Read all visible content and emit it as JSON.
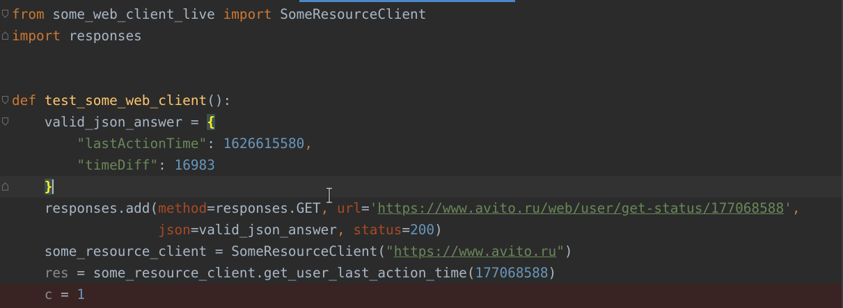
{
  "editor": {
    "language": "python",
    "accent_color": "#4a88c7",
    "lines": [
      {
        "kw_from": "from",
        "module": " some_web_client_live ",
        "kw_import": "import",
        "name": " SomeResourceClient"
      },
      {
        "kw_import": "import",
        "module": " responses"
      },
      {},
      {},
      {
        "kw_def": "def",
        "fn_name": "test_some_web_client",
        "signature_tail": "():"
      },
      {
        "var": "valid_json_answer = ",
        "brace_open": "{"
      },
      {
        "key": "\"lastActionTime\"",
        "colon": ": ",
        "value": "1626615580",
        "comma": ","
      },
      {
        "key": "\"timeDiff\"",
        "colon": ": ",
        "value": "16983"
      },
      {
        "brace_close": "}"
      },
      {
        "prefix": "responses.add(",
        "method_kw": "method",
        "method_val": "=responses.GET",
        "sep1": ", ",
        "url_kw": "url",
        "url_eq": "=",
        "quote_open": "'",
        "url_value": "https://www.avito.ru/web/user/get-status/177068588",
        "quote_close": "'",
        "tail": ","
      },
      {
        "json_kw": "json",
        "json_val": "=valid_json_answer",
        "sep": ", ",
        "status_kw": "status",
        "status_eq": "=",
        "status_val": "200",
        "close": ")"
      },
      {
        "prefix": "some_resource_client = SomeResourceClient(",
        "quote_open": "\"",
        "url_value": "https://www.avito.ru",
        "quote_close": "\"",
        "close": ")"
      },
      {
        "res": "res",
        "mid": " = some_resource_client.get_user_last_action_time(",
        "arg": "177068588",
        "close": ")"
      },
      {
        "var": "c",
        "eq": " = ",
        "value": "1"
      }
    ]
  }
}
